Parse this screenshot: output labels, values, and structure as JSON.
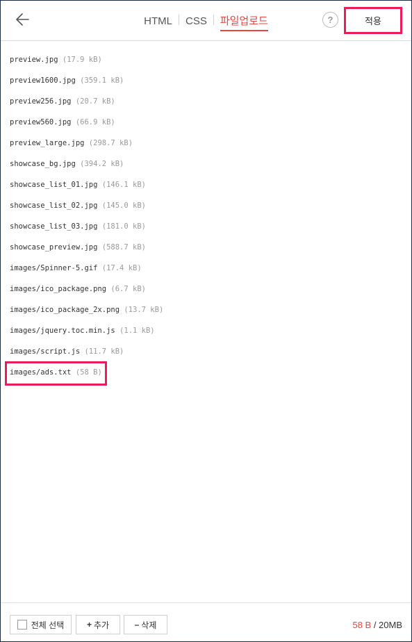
{
  "header": {
    "tabs": [
      {
        "label": "HTML",
        "active": false
      },
      {
        "label": "CSS",
        "active": false
      },
      {
        "label": "파일업로드",
        "active": true
      }
    ],
    "help_label": "?",
    "apply_label": "적용",
    "icons": {
      "back": "arrow-left-icon",
      "help": "question-icon"
    }
  },
  "files": [
    {
      "name": "preview.jpg",
      "size": "(17.9 kB)"
    },
    {
      "name": "preview1600.jpg",
      "size": "(359.1 kB)"
    },
    {
      "name": "preview256.jpg",
      "size": "(20.7 kB)"
    },
    {
      "name": "preview560.jpg",
      "size": "(66.9 kB)"
    },
    {
      "name": "preview_large.jpg",
      "size": "(298.7 kB)"
    },
    {
      "name": "showcase_bg.jpg",
      "size": "(394.2 kB)"
    },
    {
      "name": "showcase_list_01.jpg",
      "size": "(146.1 kB)"
    },
    {
      "name": "showcase_list_02.jpg",
      "size": "(145.0 kB)"
    },
    {
      "name": "showcase_list_03.jpg",
      "size": "(181.0 kB)"
    },
    {
      "name": "showcase_preview.jpg",
      "size": "(588.7 kB)"
    },
    {
      "name": "images/Spinner-5.gif",
      "size": "(17.4 kB)"
    },
    {
      "name": "images/ico_package.png",
      "size": "(6.7 kB)"
    },
    {
      "name": "images/ico_package_2x.png",
      "size": "(13.7 kB)"
    },
    {
      "name": "images/jquery.toc.min.js",
      "size": "(1.1 kB)"
    },
    {
      "name": "images/script.js",
      "size": "(11.7 kB)"
    },
    {
      "name": "images/ads.txt",
      "size": "(58 B)"
    }
  ],
  "footer": {
    "select_all_label": "전체 선택",
    "add_symbol": "+",
    "add_label": "추가",
    "delete_symbol": "–",
    "delete_label": "삭제",
    "used": "58 B",
    "total": " / 20MB"
  },
  "colors": {
    "accent": "#e8463d",
    "highlight": "#ec1b5a",
    "frame": "#1c2a4a"
  }
}
